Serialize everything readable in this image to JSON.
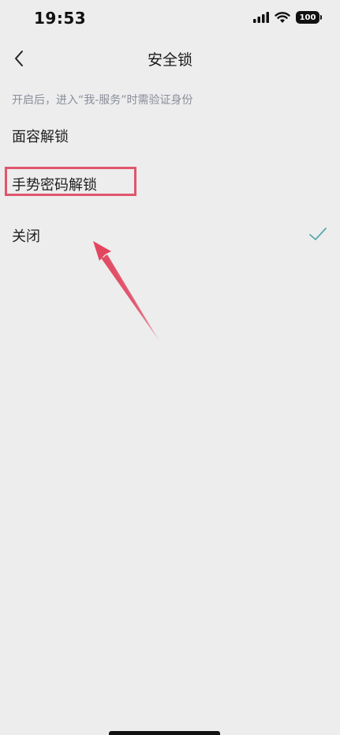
{
  "status_bar": {
    "time": "19:53",
    "battery": "100",
    "icons": [
      "signal-icon",
      "wifi-icon",
      "battery-icon"
    ]
  },
  "nav": {
    "back_icon": "chevron-left-icon",
    "title": "安全锁"
  },
  "hint": "开启后，进入“我-服务”时需验证身份",
  "options": [
    {
      "label": "面容解锁",
      "selected": false
    },
    {
      "label": "手势密码解锁",
      "selected": false,
      "highlighted": true
    },
    {
      "label": "关闭",
      "selected": true
    }
  ],
  "colors": {
    "background": "#ededed",
    "check": "#5aa8b0",
    "highlight": "#e0566e",
    "hint_text": "#8a8e9c"
  }
}
